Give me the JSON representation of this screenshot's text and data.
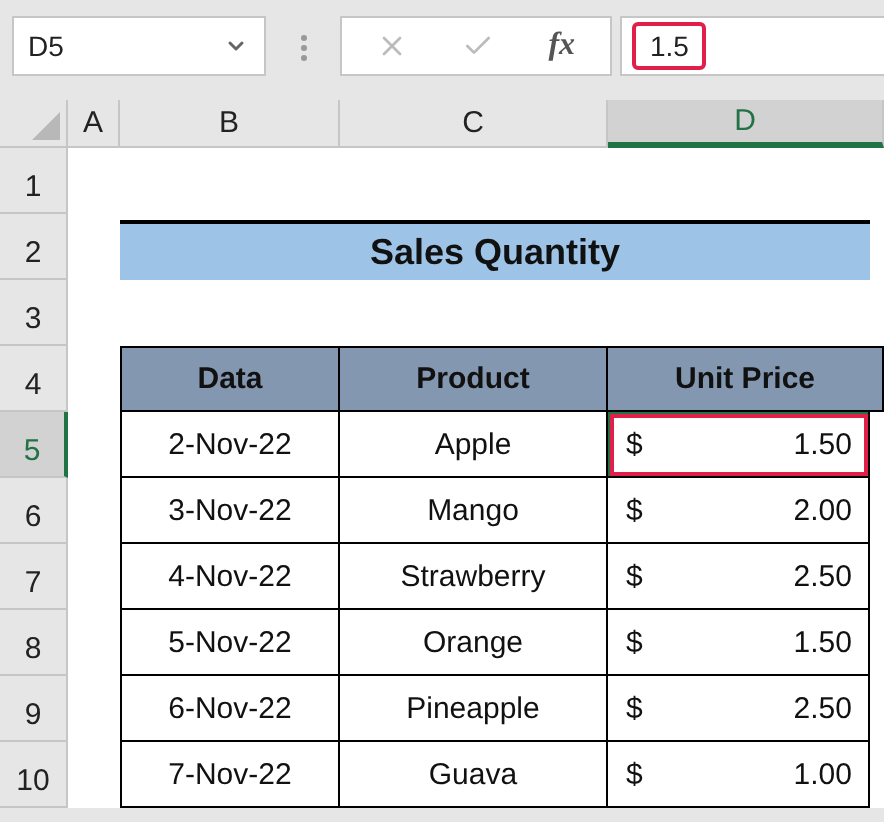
{
  "name_box": {
    "value": "D5"
  },
  "formula_bar": {
    "function_label": "fx",
    "value": "1.5",
    "highlighted": true
  },
  "columns": [
    {
      "label": "A",
      "selected": false
    },
    {
      "label": "B",
      "selected": false
    },
    {
      "label": "C",
      "selected": false
    },
    {
      "label": "D",
      "selected": true
    }
  ],
  "row_numbers": [
    {
      "label": "1",
      "selected": false
    },
    {
      "label": "2",
      "selected": false
    },
    {
      "label": "3",
      "selected": false
    },
    {
      "label": "4",
      "selected": false
    },
    {
      "label": "5",
      "selected": true
    },
    {
      "label": "6",
      "selected": false
    },
    {
      "label": "7",
      "selected": false
    },
    {
      "label": "8",
      "selected": false
    },
    {
      "label": "9",
      "selected": false
    },
    {
      "label": "10",
      "selected": false
    }
  ],
  "title": "Sales Quantity",
  "table": {
    "headers": [
      "Data",
      "Product",
      "Unit Price"
    ],
    "rows": [
      {
        "date": "2-Nov-22",
        "product": "Apple",
        "currency": "$",
        "price": "1.50",
        "selected": true
      },
      {
        "date": "3-Nov-22",
        "product": "Mango",
        "currency": "$",
        "price": "2.00",
        "selected": false
      },
      {
        "date": "4-Nov-22",
        "product": "Strawberry",
        "currency": "$",
        "price": "2.50",
        "selected": false
      },
      {
        "date": "5-Nov-22",
        "product": "Orange",
        "currency": "$",
        "price": "1.50",
        "selected": false
      },
      {
        "date": "6-Nov-22",
        "product": "Pineapple",
        "currency": "$",
        "price": "2.50",
        "selected": false
      },
      {
        "date": "7-Nov-22",
        "product": "Guava",
        "currency": "$",
        "price": "1.00",
        "selected": false
      }
    ]
  }
}
